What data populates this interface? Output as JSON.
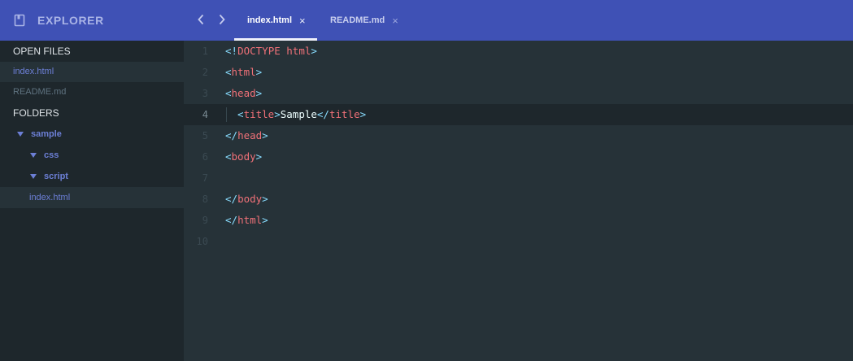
{
  "sidebar": {
    "title": "EXPLORER",
    "open_files_title": "OPEN FILES",
    "open_files": [
      {
        "label": "index.html",
        "active": true
      },
      {
        "label": "README.md",
        "active": false
      }
    ],
    "folders_title": "FOLDERS",
    "tree": {
      "root": "sample",
      "children": [
        "css",
        "script"
      ],
      "file": "index.html"
    }
  },
  "tabs": [
    {
      "label": "index.html",
      "close": "×"
    },
    {
      "label": "README.md",
      "close": "×"
    }
  ],
  "editor": {
    "line_numbers": [
      "1",
      "2",
      "3",
      "4",
      "5",
      "6",
      "7",
      "8",
      "9",
      "10"
    ],
    "current_line": 4,
    "lines": [
      [
        {
          "t": "<!",
          "c": "p"
        },
        {
          "t": "DOCTYPE html",
          "c": "t"
        },
        {
          "t": ">",
          "c": "p"
        }
      ],
      [
        {
          "t": "<",
          "c": "p"
        },
        {
          "t": "html",
          "c": "t"
        },
        {
          "t": ">",
          "c": "p"
        }
      ],
      [
        {
          "t": "<",
          "c": "p"
        },
        {
          "t": "head",
          "c": "t"
        },
        {
          "t": ">",
          "c": "p"
        }
      ],
      [
        {
          "t": "  <",
          "c": "p"
        },
        {
          "t": "title",
          "c": "t"
        },
        {
          "t": ">",
          "c": "p"
        },
        {
          "t": "Sample",
          "c": "x"
        },
        {
          "t": "</",
          "c": "p"
        },
        {
          "t": "title",
          "c": "t"
        },
        {
          "t": ">",
          "c": "p"
        }
      ],
      [
        {
          "t": "</",
          "c": "p"
        },
        {
          "t": "head",
          "c": "t"
        },
        {
          "t": ">",
          "c": "p"
        }
      ],
      [
        {
          "t": "<",
          "c": "p"
        },
        {
          "t": "body",
          "c": "t"
        },
        {
          "t": ">",
          "c": "p"
        }
      ],
      [],
      [
        {
          "t": "</",
          "c": "p"
        },
        {
          "t": "body",
          "c": "t"
        },
        {
          "t": ">",
          "c": "p"
        }
      ],
      [
        {
          "t": "</",
          "c": "p"
        },
        {
          "t": "html",
          "c": "t"
        },
        {
          "t": ">",
          "c": "p"
        }
      ],
      []
    ]
  },
  "colors": {
    "accent": "#3f51b5",
    "sidebar_bg": "#1e272c",
    "editor_bg": "#263238",
    "punctuation": "#89ddff",
    "tag": "#f07178",
    "text": "#eeffff"
  },
  "icons": {
    "explorer": "book-icon",
    "back": "chevron-left-icon",
    "forward": "chevron-right-icon",
    "close": "close-icon",
    "folder_expanded": "triangle-down-icon"
  }
}
